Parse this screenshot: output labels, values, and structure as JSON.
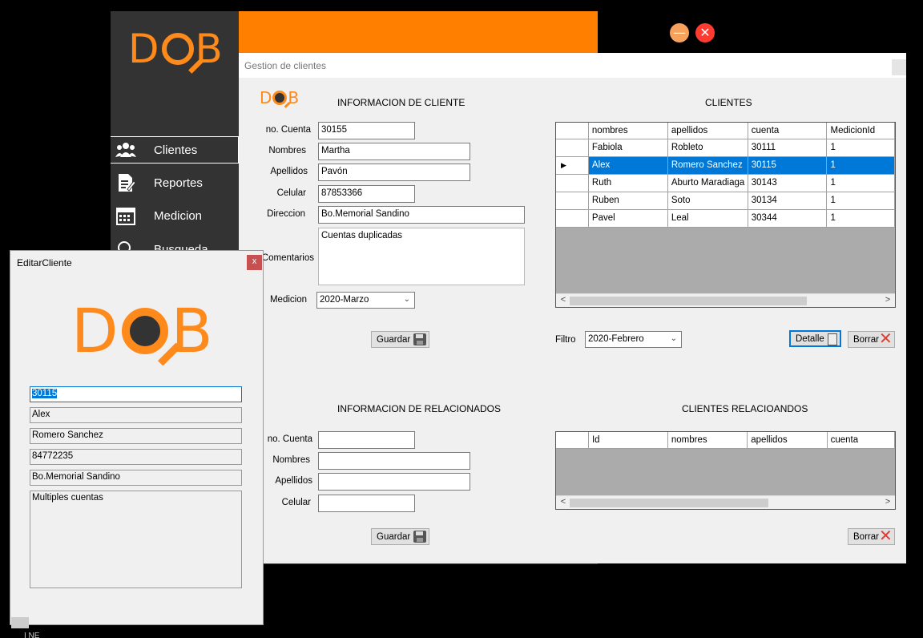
{
  "app": {
    "logo_text": "DQB",
    "minimize_symbol": "—",
    "close_symbol": "✕",
    "sidebar": [
      {
        "label": "Clientes",
        "icon": "users-icon"
      },
      {
        "label": "Reportes",
        "icon": "report-icon"
      },
      {
        "label": "Medicion",
        "icon": "calendar-icon"
      },
      {
        "label": "Busqueda",
        "icon": "search-icon"
      }
    ]
  },
  "gestion": {
    "title": "Gestion de clientes",
    "logo_text": "DQB",
    "info_cliente_title": "INFORMACION DE CLIENTE",
    "clientes_title": "CLIENTES",
    "labels": {
      "cuenta": "no. Cuenta",
      "nombres": "Nombres",
      "apellidos": "Apellidos",
      "celular": "Celular",
      "direccion": "Direccion",
      "comentarios": "Comentarios",
      "medicion": "Medicion",
      "filtro": "Filtro"
    },
    "form": {
      "cuenta": "30155",
      "nombres": "Martha",
      "apellidos": "Pavón",
      "celular": "87853366",
      "direccion": "Bo.Memorial Sandino",
      "comentarios": "Cuentas duplicadas",
      "medicion": "2020-Marzo"
    },
    "guardar_label": "Guardar",
    "filtro_value": "2020-Febrero",
    "detalle_label": "Detalle",
    "borrar_label": "Borrar",
    "clientes_columns": [
      "nombres",
      "apellidos",
      "cuenta",
      "MedicionId"
    ],
    "clientes_rows": [
      [
        "Fabiola",
        "Robleto",
        "30111",
        "1"
      ],
      [
        "Alex",
        "Romero Sanchez",
        "30115",
        "1"
      ],
      [
        "Ruth",
        "Aburto Maradiaga",
        "30143",
        "1"
      ],
      [
        "Ruben",
        "Soto",
        "30134",
        "1"
      ],
      [
        "Pavel",
        "Leal",
        "30344",
        "1"
      ]
    ],
    "selected_row": 1,
    "info_rel_title": "INFORMACION DE RELACIONADOS",
    "rel_title": "CLIENTES RELACIOANDOS",
    "rel_form": {
      "cuenta": "",
      "nombres": "",
      "apellidos": "",
      "celular": ""
    },
    "rel_columns": [
      "Id",
      "nombres",
      "apellidos",
      "cuenta"
    ],
    "guardar2_label": "Guardar",
    "borrar2_label": "Borrar"
  },
  "editar": {
    "title": "EditarCliente",
    "close_symbol": "x",
    "logo_text": "DQB",
    "cuenta": "30115",
    "nombres": "Alex",
    "apellidos": "Romero Sanchez",
    "celular": "84772235",
    "direccion": "Bo.Memorial Sandino",
    "comentarios": "Multiples cuentas"
  },
  "bottom_text": "I NE"
}
